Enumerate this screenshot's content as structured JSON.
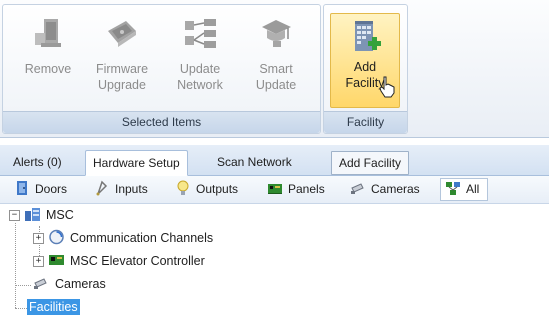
{
  "ribbon": {
    "groups": {
      "selected_items": {
        "label": "Selected Items",
        "buttons": [
          {
            "label": "Remove",
            "icon": "remove-controller-icon",
            "enabled": false
          },
          {
            "label": "Firmware\nUpgrade",
            "icon": "firmware-chip-icon",
            "enabled": false
          },
          {
            "label": "Update\nNetwork",
            "icon": "network-icon",
            "enabled": false
          },
          {
            "label": "Smart\nUpdate",
            "icon": "smart-update-icon",
            "enabled": false
          }
        ]
      },
      "facility": {
        "label": "Facility",
        "buttons": [
          {
            "label": "Add\nFacility",
            "icon": "building-add-icon",
            "enabled": true,
            "hovered": true
          }
        ]
      }
    }
  },
  "tabs": [
    {
      "label": "Alerts (0)",
      "active": false
    },
    {
      "label": "Hardware Setup",
      "active": true
    },
    {
      "label": "Scan Network",
      "active": false
    },
    {
      "label": "Add Facility",
      "active": false
    }
  ],
  "categories": [
    {
      "label": "Doors",
      "icon": "door-icon"
    },
    {
      "label": "Inputs",
      "icon": "input-icon"
    },
    {
      "label": "Outputs",
      "icon": "output-bulb-icon"
    },
    {
      "label": "Panels",
      "icon": "panel-board-icon"
    },
    {
      "label": "Cameras",
      "icon": "camera-icon"
    },
    {
      "label": "All",
      "icon": "all-network-icon",
      "active": true
    }
  ],
  "tree": {
    "root": {
      "label": "MSC",
      "expanded": true,
      "icon": "server-icon"
    },
    "children": [
      {
        "label": "Communication Channels",
        "icon": "channel-icon",
        "expandable": true
      },
      {
        "label": "MSC Elevator Controller",
        "icon": "controller-board-icon",
        "expandable": true
      }
    ],
    "siblings": [
      {
        "label": "Cameras",
        "icon": "camera-icon"
      },
      {
        "label": "Facilities",
        "selected": true
      }
    ]
  },
  "colors": {
    "ribbon_bg": "#eef2f7",
    "hover_button": "#ffd76a",
    "selection": "#3b96e5",
    "tabstrip": "#d3e1f2"
  }
}
